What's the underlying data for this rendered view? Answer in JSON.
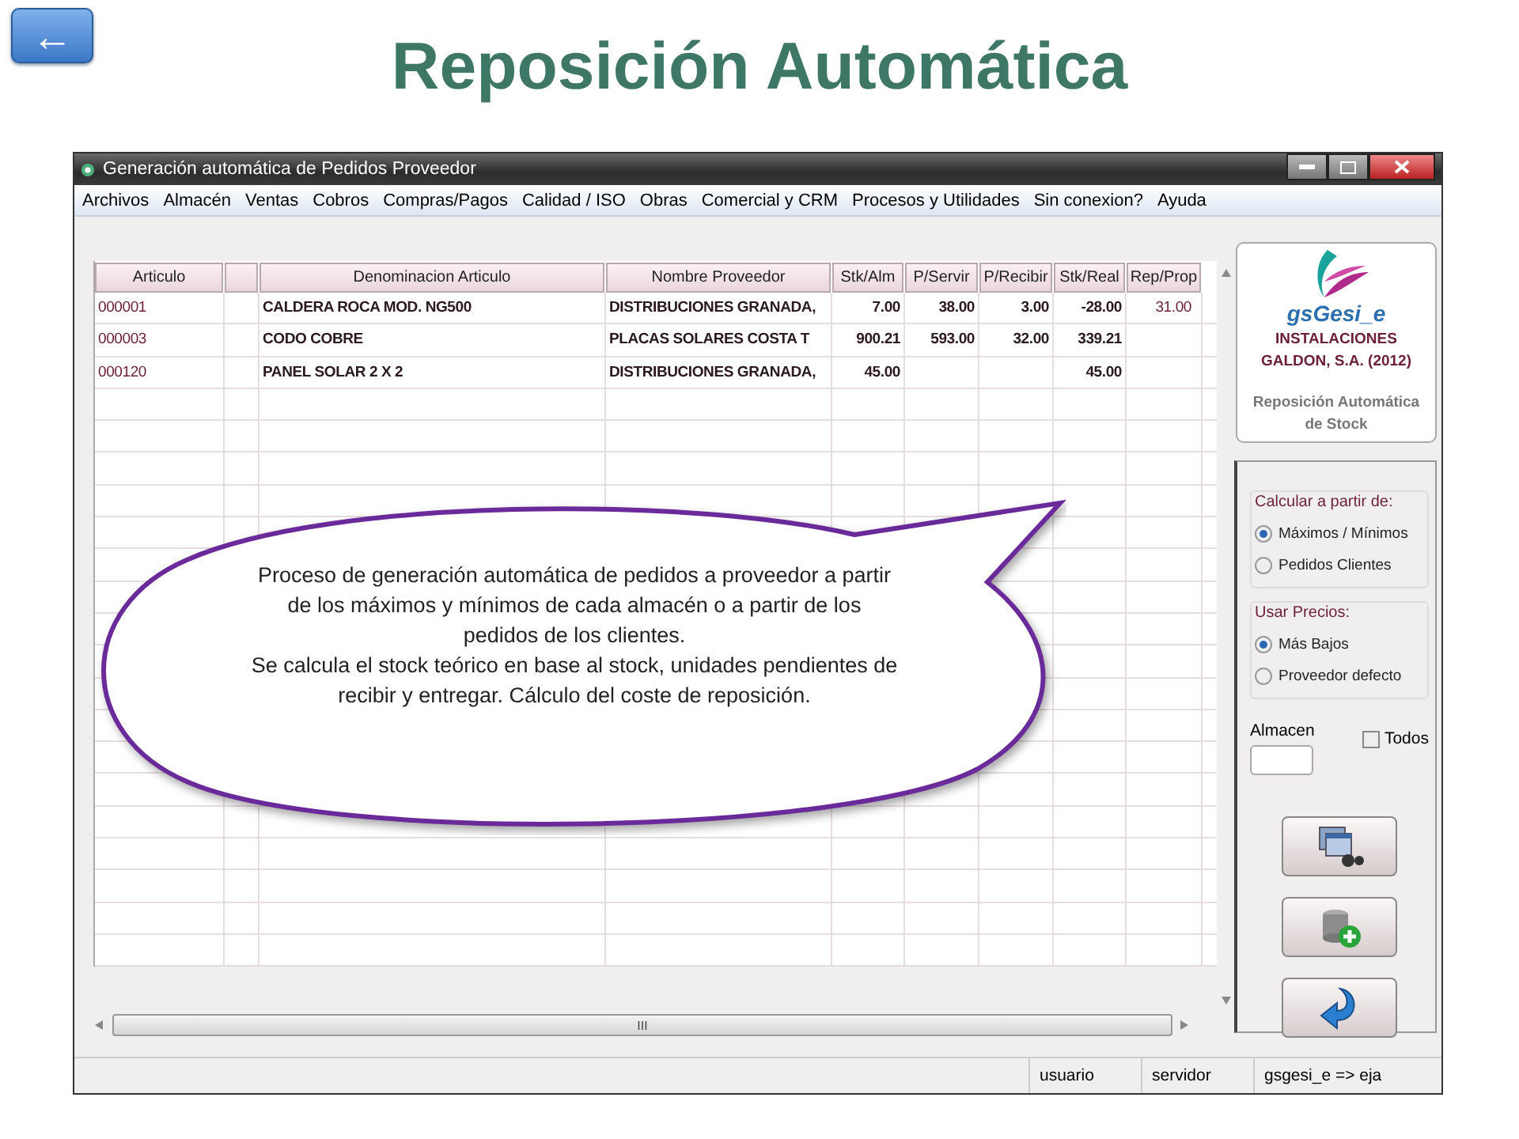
{
  "back_button": {
    "label": "←"
  },
  "title": "Reposición Automática",
  "window": {
    "title": "Generación automática de Pedidos Proveedor",
    "menu": [
      "Archivos",
      "Almacén",
      "Ventas",
      "Cobros",
      "Compras/Pagos",
      "Calidad / ISO",
      "Obras",
      "Comercial y CRM",
      "Procesos y Utilidades",
      "Sin conexion?",
      "Ayuda"
    ],
    "table": {
      "columns": [
        {
          "label": "Articulo",
          "kind": "code"
        },
        {
          "kind": "blank"
        },
        {
          "label": "Denominacion Articulo",
          "kind": "text"
        },
        {
          "label": "Nombre Proveedor",
          "kind": "text"
        },
        {
          "label": "Stk/Alm",
          "kind": "number"
        },
        {
          "label": "P/Servir",
          "kind": "number"
        },
        {
          "label": "P/Recibir",
          "kind": "number"
        },
        {
          "label": "Stk/Real",
          "kind": "number"
        },
        {
          "label": "Rep/Prop",
          "kind": "plain"
        }
      ],
      "rows": [
        {
          "articulo": "000001",
          "denominacion": "CALDERA ROCA MOD. NG500",
          "proveedor": "DISTRIBUCIONES GRANADA,",
          "stk_alm": "7.00",
          "p_servir": "38.00",
          "p_recibir": "3.00",
          "stk_real": "-28.00",
          "rep_prop": "31.00"
        },
        {
          "articulo": "000003",
          "denominacion": "CODO COBRE",
          "proveedor": "PLACAS SOLARES COSTA T",
          "stk_alm": "900.21",
          "p_servir": "593.00",
          "p_recibir": "32.00",
          "stk_real": "339.21"
        },
        {
          "articulo": "000120",
          "denominacion": "PANEL SOLAR 2 X 2",
          "proveedor": "DISTRIBUCIONES GRANADA,",
          "stk_alm": "45.00",
          "stk_real": "45.00"
        }
      ],
      "scroll_thumb_label": "III"
    },
    "logo_card": {
      "brand": "gsGesi_e",
      "company": "INSTALACIONES GALDON, S.A. (2012)",
      "caption": "Reposición Automática de Stock"
    },
    "calc_group": {
      "title": "Calcular a partir de:",
      "options": [
        {
          "label": "Máximos / Mínimos",
          "selected": true
        },
        {
          "label": "Pedidos Clientes",
          "selected": false
        }
      ]
    },
    "price_group": {
      "title": "Usar Precios:",
      "options": [
        {
          "label": "Más Bajos",
          "selected": true
        },
        {
          "label": "Proveedor defecto",
          "selected": false
        }
      ]
    },
    "almacen": {
      "label": "Almacen"
    },
    "todos": {
      "label": "Todos",
      "checked": false
    },
    "action_buttons": [
      {
        "kind": "search"
      },
      {
        "kind": "add-database"
      },
      {
        "kind": "back"
      }
    ],
    "status_bar": [
      "usuario",
      "servidor",
      "gsgesi_e => eja"
    ]
  },
  "callout": {
    "paragraphs": [
      "Proceso de generación automática de pedidos a proveedor a partir de los máximos y mínimos de cada almacén o a partir de los pedidos de los clientes.",
      "Se calcula el stock teórico en base al stock, unidades pendientes de recibir y entregar.  Cálculo del coste de reposición."
    ]
  }
}
